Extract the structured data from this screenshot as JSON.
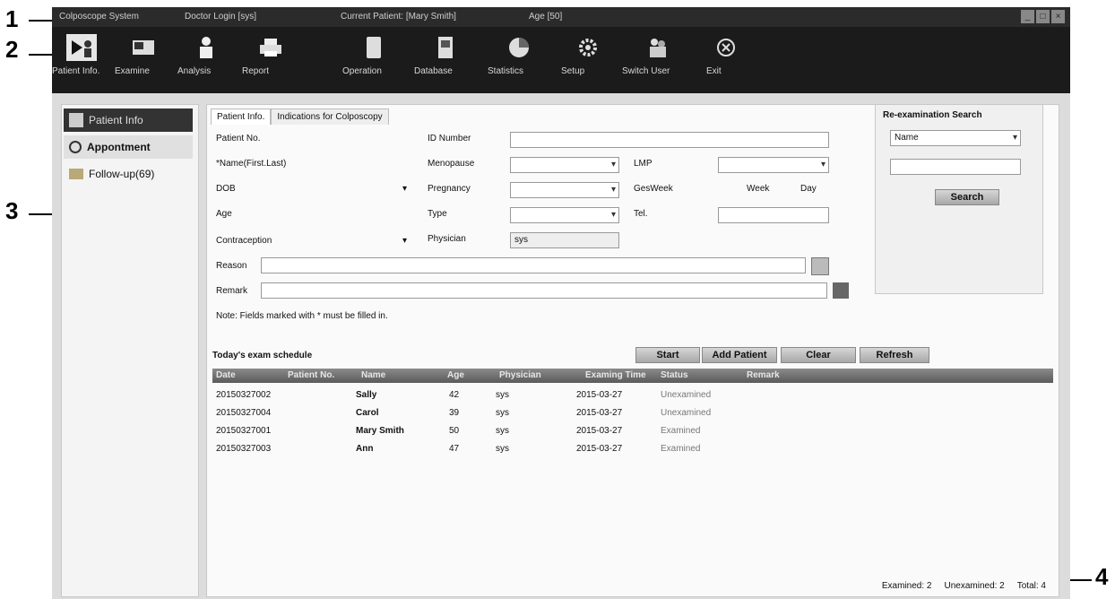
{
  "title": {
    "app": "Colposcope System",
    "login": "Doctor Login [sys]",
    "patient": "Current Patient: [Mary Smith]",
    "age": "Age [50]"
  },
  "toolbar": [
    "Patient Info.",
    "Examine",
    "Analysis",
    "Report",
    "Operation",
    "Database",
    "Statistics",
    "Setup",
    "Switch User",
    "Exit"
  ],
  "sidebar": [
    "Patient Info",
    "Appontment",
    "Follow-up(69)"
  ],
  "tabs": [
    "Patient Info.",
    "Indications for Colposcopy"
  ],
  "form": {
    "patient_no": "Patient No.",
    "id_number": "ID Number",
    "name": "*Name(First.Last)",
    "menopause": "Menopause",
    "lmp": "LMP",
    "dob": "DOB",
    "pregnancy": "Pregnancy",
    "gesweek": "GesWeek",
    "week": "Week",
    "day": "Day",
    "age": "Age",
    "type": "Type",
    "tel": "Tel.",
    "contraception": "Contraception",
    "physician": "Physician",
    "physician_value": "sys",
    "reason": "Reason",
    "remark": "Remark",
    "note": "Note: Fields marked with * must be filled in."
  },
  "schedule": {
    "title": "Today's exam schedule",
    "buttons": [
      "Start",
      "Add Patient",
      "Clear",
      "Refresh"
    ],
    "headers": [
      "Date",
      "Patient No.",
      "Name",
      "Age",
      "Physician",
      "Examing Time",
      "Status",
      "Remark"
    ],
    "rows": [
      [
        "20150327002",
        "Sally",
        "42",
        "sys",
        "2015-03-27",
        "Unexamined"
      ],
      [
        "20150327004",
        "Carol",
        "39",
        "sys",
        "2015-03-27",
        "Unexamined"
      ],
      [
        "20150327001",
        "Mary Smith",
        "50",
        "sys",
        "2015-03-27",
        "Examined"
      ],
      [
        "20150327003",
        "Ann",
        "47",
        "sys",
        "2015-03-27",
        "Examined"
      ]
    ]
  },
  "summary": {
    "examined": "Examined: 2",
    "unexamined": "Unexamined: 2",
    "total": "Total: 4"
  },
  "search": {
    "title": "Re-examination Search",
    "select": "Name",
    "button": "Search"
  },
  "callouts": [
    "1",
    "2",
    "3",
    "4"
  ]
}
